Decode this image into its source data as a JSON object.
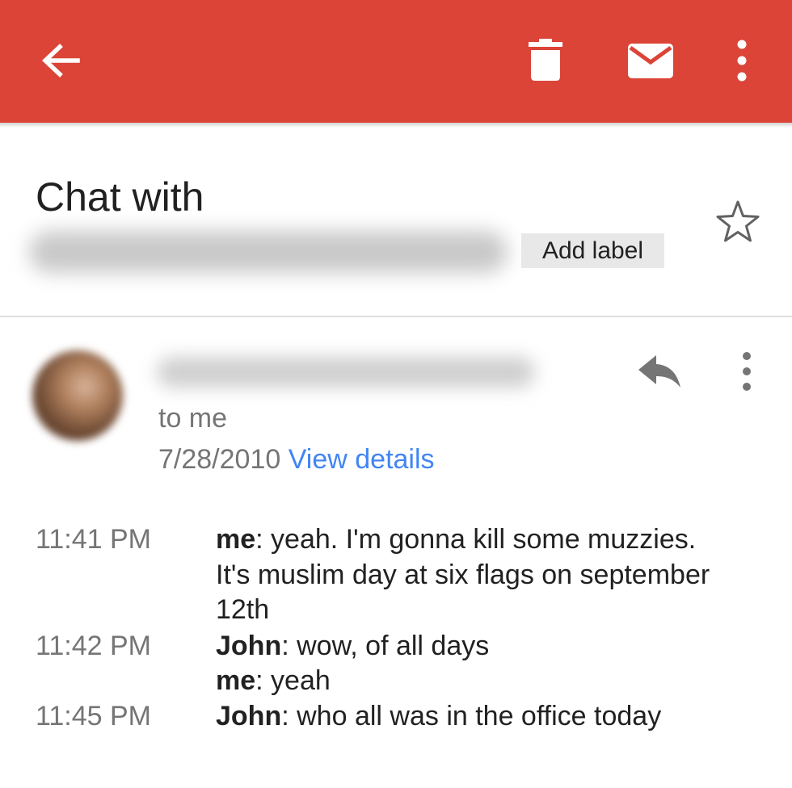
{
  "toolbar": {
    "back_icon": "arrow-left-icon",
    "delete_icon": "trash-icon",
    "mail_icon": "envelope-icon",
    "more_icon": "more-vertical-icon",
    "color": "#db4437"
  },
  "subject": {
    "title": "Chat with",
    "add_label": "Add label",
    "star_icon": "star-outline-icon"
  },
  "message": {
    "recipient": "to me",
    "date": "7/28/2010",
    "view_details": "View details",
    "reply_icon": "reply-icon",
    "more_icon": "more-vertical-icon",
    "link_color": "#4285f4"
  },
  "chat": [
    {
      "time": "11:41 PM",
      "sender": "me",
      "lines": [
        "yeah. I'm gonna kill some muzzies.",
        "It's muslim day at six flags on september",
        "12th"
      ]
    },
    {
      "time": "11:42 PM",
      "sender": "John",
      "lines": [
        "wow, of all days"
      ]
    },
    {
      "time": "",
      "sender": "me",
      "lines": [
        "yeah"
      ]
    },
    {
      "time": "11:45 PM",
      "sender": "John",
      "lines": [
        "who all was in the office today"
      ]
    }
  ]
}
